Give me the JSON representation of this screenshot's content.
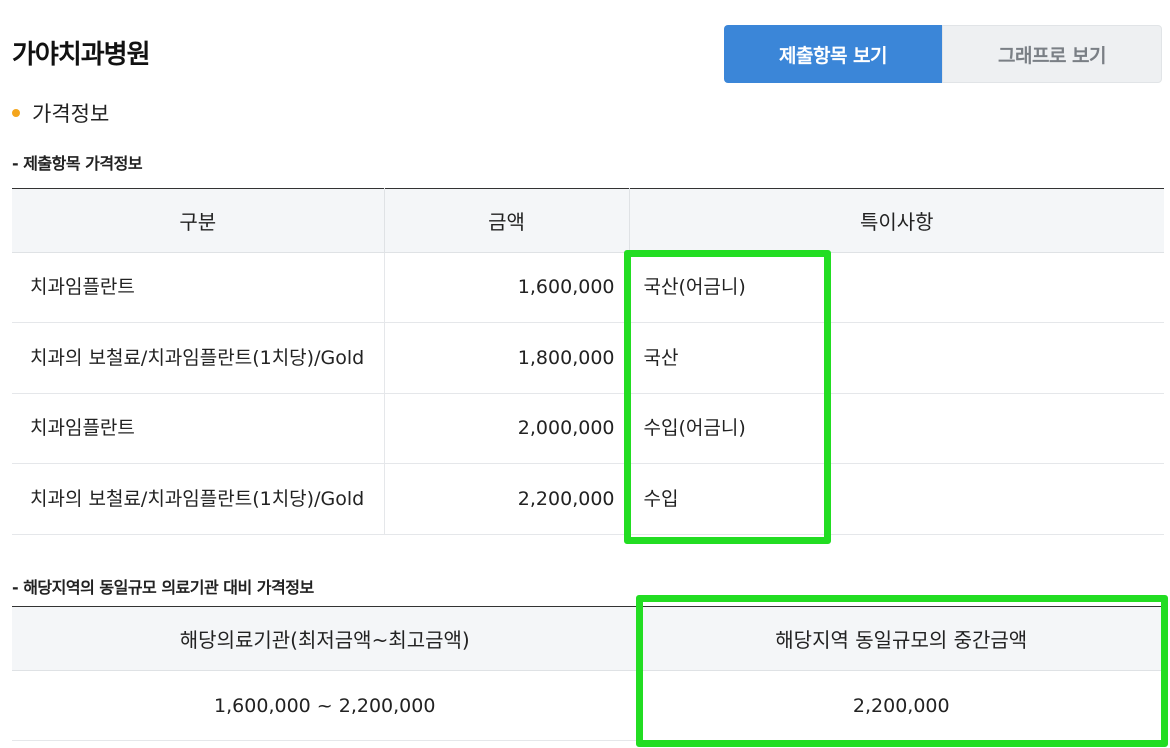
{
  "hospital_name": "가야치과병원",
  "view_toggle": {
    "submitted_items_label": "제출항목 보기",
    "graph_label": "그래프로 보기"
  },
  "section": {
    "title": "가격정보",
    "bullet_color": "#f4a51c"
  },
  "price_table": {
    "subtitle": "- 제출항목 가격정보",
    "headers": [
      "구분",
      "금액",
      "특이사항"
    ],
    "rows": [
      {
        "category": "치과임플란트",
        "amount": "1,600,000",
        "note": "국산(어금니)"
      },
      {
        "category": "치과의 보철료/치과임플란트(1치당)/Gold",
        "amount": "1,800,000",
        "note": "국산"
      },
      {
        "category": "치과임플란트",
        "amount": "2,000,000",
        "note": "수입(어금니)"
      },
      {
        "category": "치과의 보철료/치과임플란트(1치당)/Gold",
        "amount": "2,200,000",
        "note": "수입"
      }
    ]
  },
  "regional_table": {
    "subtitle": "- 해당지역의 동일규모 의료기관 대비 가격정보",
    "headers": [
      "해당의료기관(최저금액~최고금액)",
      "해당지역 동일규모의 중간금액"
    ],
    "range_value": "1,600,000 ~ 2,200,000",
    "median_value": "2,200,000"
  },
  "colors": {
    "active_button": "#3b86d8",
    "highlight": "#22dd22"
  }
}
